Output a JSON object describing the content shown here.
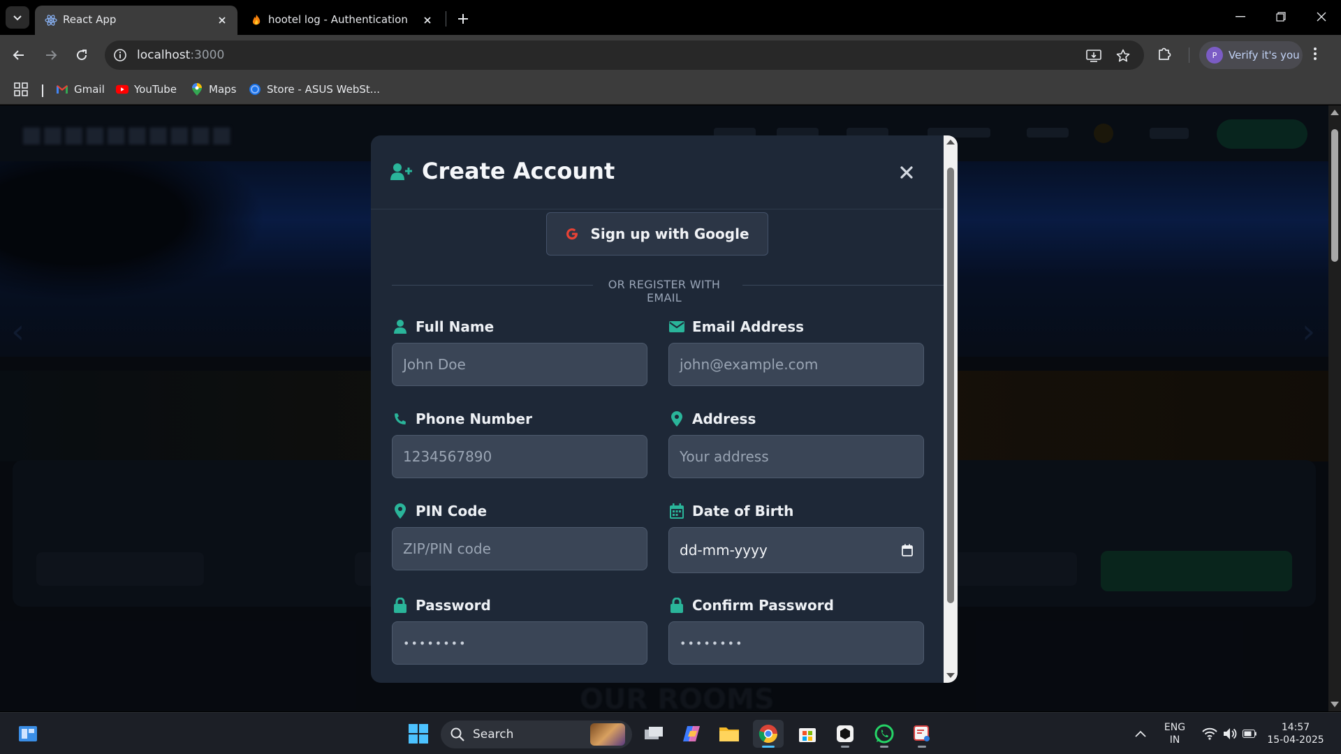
{
  "browser": {
    "tabs": [
      {
        "title": "React App",
        "active": true
      },
      {
        "title": "hootel log - Authentication - Us",
        "active": false
      }
    ],
    "url": {
      "host": "localhost",
      "port": ":3000"
    },
    "verify_label": "Verify it's you",
    "profile_initial": "P",
    "bookmarks": [
      {
        "label": "Gmail",
        "icon": "gmail-icon"
      },
      {
        "label": "YouTube",
        "icon": "youtube-icon"
      },
      {
        "label": "Maps",
        "icon": "maps-icon"
      },
      {
        "label": "Store - ASUS WebSt...",
        "icon": "asus-store-icon"
      }
    ]
  },
  "modal": {
    "title": "Create Account",
    "google_button": "Sign up with Google",
    "divider": "OR REGISTER WITH EMAIL",
    "fields": {
      "full_name": {
        "label": "Full Name",
        "placeholder": "John Doe"
      },
      "email": {
        "label": "Email Address",
        "placeholder": "john@example.com"
      },
      "phone": {
        "label": "Phone Number",
        "placeholder": "1234567890"
      },
      "address": {
        "label": "Address",
        "placeholder": "Your address"
      },
      "pin": {
        "label": "PIN Code",
        "placeholder": "ZIP/PIN code"
      },
      "dob": {
        "label": "Date of Birth",
        "value": "dd-mm-yyyy"
      },
      "password": {
        "label": "Password",
        "value": "••••••••"
      },
      "confirm_password": {
        "label": "Confirm Password",
        "value": "••••••••"
      }
    },
    "accent_color": "#2ab59a"
  },
  "background_page": {
    "rooms_heading": "OUR ROOMS"
  },
  "taskbar": {
    "search_label": "Search",
    "lang_top": "ENG",
    "lang_bottom": "IN",
    "time": "14:57",
    "date": "15-04-2025"
  }
}
